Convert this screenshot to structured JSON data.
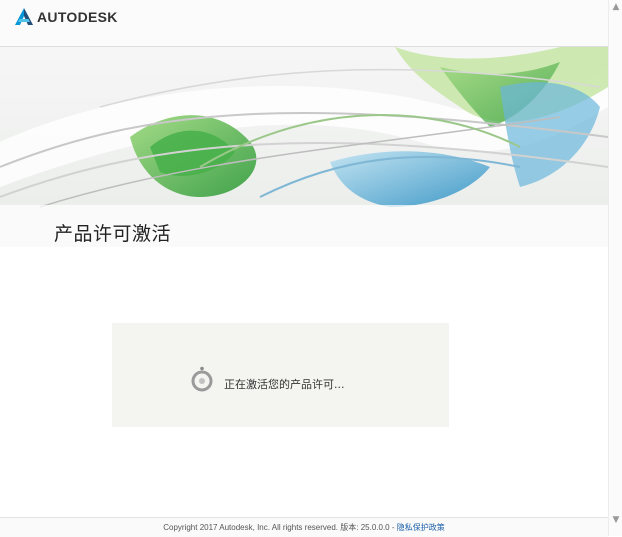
{
  "header": {
    "logo_text": "AUTODESK",
    "logo_icon": "autodesk-logo-icon"
  },
  "banner": {
    "title": "产品许可激活"
  },
  "status": {
    "message": "正在激活您的产品许可...",
    "icon": "spinner-icon"
  },
  "footer": {
    "copyright": "Copyright 2017 Autodesk, Inc. All rights reserved.",
    "version_label": "版本:",
    "version": "25.0.0.0 -",
    "privacy_link": "隐私保护政策"
  },
  "scrollbar": {
    "up_icon": "scroll-up-icon",
    "down_icon": "scroll-down-icon"
  },
  "colors": {
    "link": "#1a5fa8",
    "status_box": "#f4f4f0",
    "logo_teal": "#0696d7"
  }
}
